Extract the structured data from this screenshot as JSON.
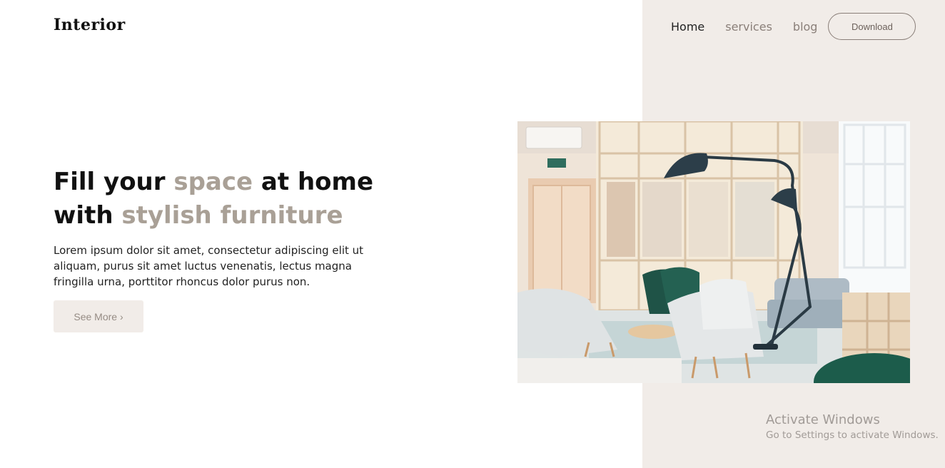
{
  "header": {
    "logo": "Interior",
    "nav": {
      "items": [
        {
          "label": "Home"
        },
        {
          "label": "services"
        },
        {
          "label": "blog"
        }
      ],
      "download_label": "Download"
    }
  },
  "hero": {
    "title": {
      "line1_part1": "Fill your ",
      "line1_accent": "space",
      "line1_part2": " at home",
      "line2_part1": "with ",
      "line2_accent": "stylish furniture"
    },
    "description": "Lorem ipsum dolor sit amet, consectetur adipiscing elit ut aliquam, purus sit amet luctus venenatis, lectus magna fringilla urna, porttitor rhoncus dolor purus non.",
    "cta_label": "See More ›"
  },
  "watermark": {
    "title": "Activate Windows",
    "subtitle": "Go to Settings to activate Windows."
  },
  "colors": {
    "accent": "#a9a096",
    "panel": "#f1ece8",
    "text": "#111111"
  }
}
